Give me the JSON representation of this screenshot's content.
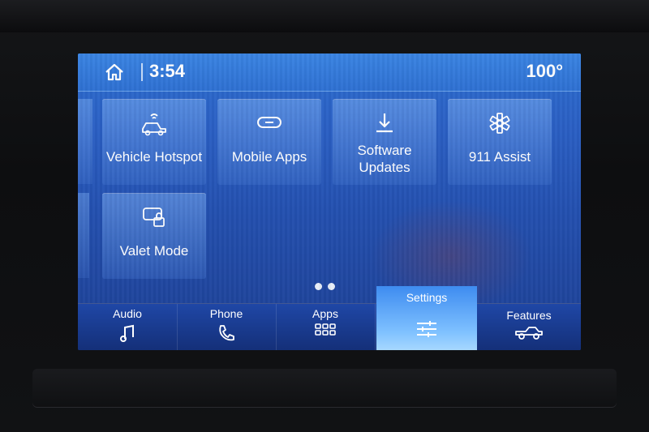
{
  "status_bar": {
    "time": "3:54",
    "temperature": "100°"
  },
  "tiles": [
    {
      "label": "Vehicle Hotspot",
      "icon": "vehicle-wifi-icon"
    },
    {
      "label": "Mobile Apps",
      "icon": "link-icon"
    },
    {
      "label": "Software Updates",
      "icon": "download-icon"
    },
    {
      "label": "911 Assist",
      "icon": "star-of-life-icon"
    },
    {
      "label": "Valet Mode",
      "icon": "car-lock-icon"
    }
  ],
  "page_indicator": {
    "pages": 2
  },
  "nav": {
    "audio": "Audio",
    "phone": "Phone",
    "apps": "Apps",
    "settings": "Settings",
    "features": "Features",
    "active": "Settings"
  },
  "colors": {
    "screen_top": "#2d6fd0",
    "screen_bottom": "#1d3f93",
    "active_tab": "#7ec0ff"
  }
}
